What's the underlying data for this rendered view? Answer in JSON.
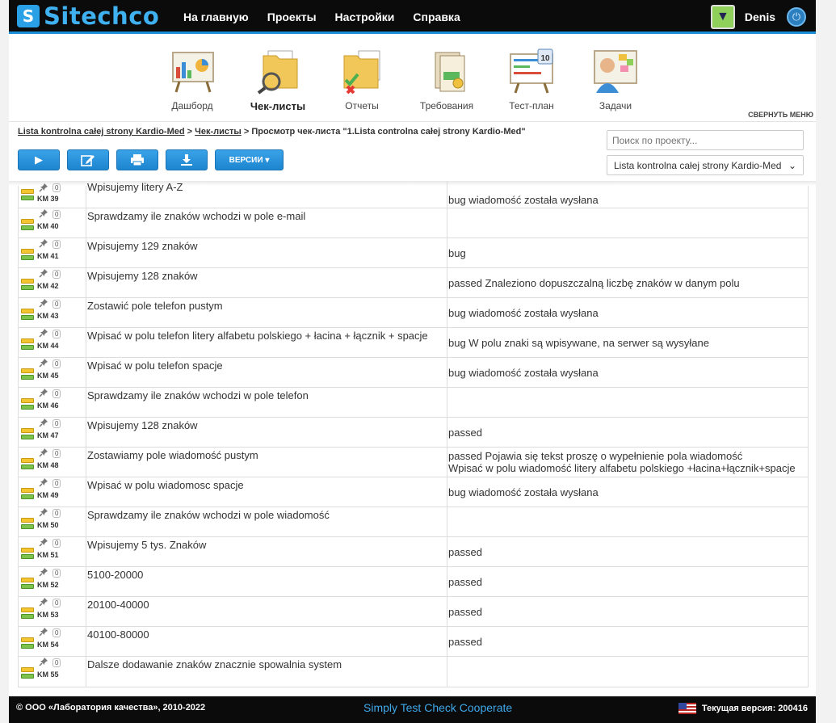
{
  "app": {
    "logo_text": "Sitechco",
    "nav": [
      "На главную",
      "Проекты",
      "Настройки",
      "Справка"
    ],
    "user": "Denis"
  },
  "modules": {
    "items": [
      {
        "label": "Дашборд",
        "icon": "dashboard-icon",
        "active": false
      },
      {
        "label": "Чек-листы",
        "icon": "checklists-icon",
        "active": true
      },
      {
        "label": "Отчеты",
        "icon": "reports-icon",
        "active": false
      },
      {
        "label": "Требования",
        "icon": "requirements-icon",
        "active": false
      },
      {
        "label": "Тест-план",
        "icon": "test-plan-icon",
        "active": false
      },
      {
        "label": "Задачи",
        "icon": "tasks-icon",
        "active": false
      }
    ],
    "collapse_label": "СВЕРНУТЬ МЕНЮ",
    "calendar_day": "10"
  },
  "breadcrumb": {
    "project": "Lista kontrolna całej strony Kardio-Med",
    "sep1": " > ",
    "checklists": "Чек-листы",
    "current": " > Просмотр чек-листа \"1.Lista controlna całej strony Kardio-Med\""
  },
  "toolbar": {
    "versions_label": "ВЕРСИИ ▾"
  },
  "search": {
    "placeholder": "Поиск по проекту..."
  },
  "project_select": {
    "value": "Lista kontrolna całej strony Kardio-Med"
  },
  "rows": [
    {
      "km": "KM 39",
      "count": "0",
      "step": "Wpisujemy litery A-Z",
      "result": "bug wiadomość została wysłana"
    },
    {
      "km": "KM 40",
      "count": "0",
      "step": "Sprawdzamy ile znaków wchodzi w pole e-mail",
      "result": ""
    },
    {
      "km": "KM 41",
      "count": "0",
      "step": "Wpisujemy 129 znaków",
      "result": "bug"
    },
    {
      "km": "KM 42",
      "count": "0",
      "step": "Wpisujemy 128 znaków",
      "result": "passed Znaleziono dopuszczalną liczbę znaków w danym polu"
    },
    {
      "km": "KM 43",
      "count": "0",
      "step": "Zostawić pole telefon pustym",
      "result": "bug wiadomość została wysłana"
    },
    {
      "km": "KM 44",
      "count": "0",
      "step": "Wpisać w polu telefon litery alfabetu polskiego + łacina + łącznik + spacje",
      "result": "bug W polu znaki są wpisywane, na serwer są wysyłane"
    },
    {
      "km": "KM 45",
      "count": "0",
      "step": "Wpisać w polu telefon spacje",
      "result": "bug wiadomość została wysłana"
    },
    {
      "km": "KM 46",
      "count": "0",
      "step": "Sprawdzamy ile znaków wchodzi w pole telefon",
      "result": ""
    },
    {
      "km": "KM 47",
      "count": "0",
      "step": "Wpisujemy 128 znaków",
      "result": "passed"
    },
    {
      "km": "KM 48",
      "count": "0",
      "step": "Zostawiamy pole wiadomość pustym",
      "result": "passed Pojawia się tekst proszę o wypełnienie pola wiadomość\nWpisać w polu wiadomość litery alfabetu polskiego +łacina+łącznik+spacje"
    },
    {
      "km": "KM 49",
      "count": "0",
      "step": "Wpisać w polu wiadomosc spacje",
      "result": "bug wiadomość została wysłana"
    },
    {
      "km": "KM 50",
      "count": "0",
      "step": "Sprawdzamy ile znaków wchodzi w pole wiadomość",
      "result": ""
    },
    {
      "km": "KM 51",
      "count": "0",
      "step": "Wpisujemy 5 tys. Znaków",
      "result": "passed"
    },
    {
      "km": "KM 52",
      "count": "0",
      "step": "5100-20000",
      "result": "passed"
    },
    {
      "km": "KM 53",
      "count": "0",
      "step": "20100-40000",
      "result": "passed"
    },
    {
      "km": "KM 54",
      "count": "0",
      "step": "40100-80000",
      "result": "passed"
    },
    {
      "km": "KM 55",
      "count": "0",
      "step": "Dalsze dodawanie znaków znacznie spowalnia system",
      "result": ""
    }
  ],
  "footer": {
    "copyright": "© ООО «Лаборатория качества», 2010-2022",
    "slogan": "Simply Test Check Cooperate",
    "version": "Текущая версия: 200416"
  }
}
